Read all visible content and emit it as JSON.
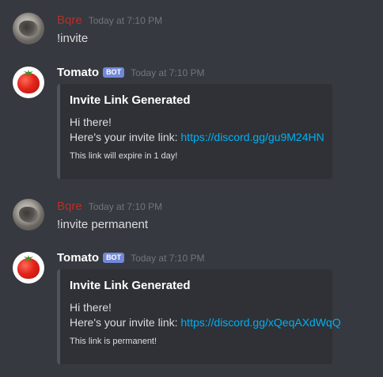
{
  "colors": {
    "background": "#36393f",
    "user_name": "#b4302b",
    "bot_tag": "#7289da",
    "link": "#00b0f4",
    "embed_bg": "#2f3136",
    "embed_border": "#4f545c"
  },
  "messages": [
    {
      "author": "Bqre",
      "timestamp": "Today at 7:10 PM",
      "text": "!invite",
      "avatar_icon": "user-avatar-photo"
    },
    {
      "author": "Tomato",
      "bot_tag": "BOT",
      "timestamp": "Today at 7:10 PM",
      "avatar_icon": "tomato-icon",
      "embed": {
        "title": "Invite Link Generated",
        "greeting": "Hi there!",
        "link_prefix": "Here's your invite link: ",
        "link": "https://discord.gg/gu9M24HN",
        "footer": "This link will expire in 1 day!"
      }
    },
    {
      "author": "Bqre",
      "timestamp": "Today at 7:10 PM",
      "text": "!invite permanent",
      "avatar_icon": "user-avatar-photo"
    },
    {
      "author": "Tomato",
      "bot_tag": "BOT",
      "timestamp": "Today at 7:10 PM",
      "avatar_icon": "tomato-icon",
      "embed": {
        "title": "Invite Link Generated",
        "greeting": "Hi there!",
        "link_prefix": "Here's your invite link: ",
        "link": "https://discord.gg/xQeqAXdWqQ",
        "footer": "This link is permanent!"
      }
    }
  ]
}
